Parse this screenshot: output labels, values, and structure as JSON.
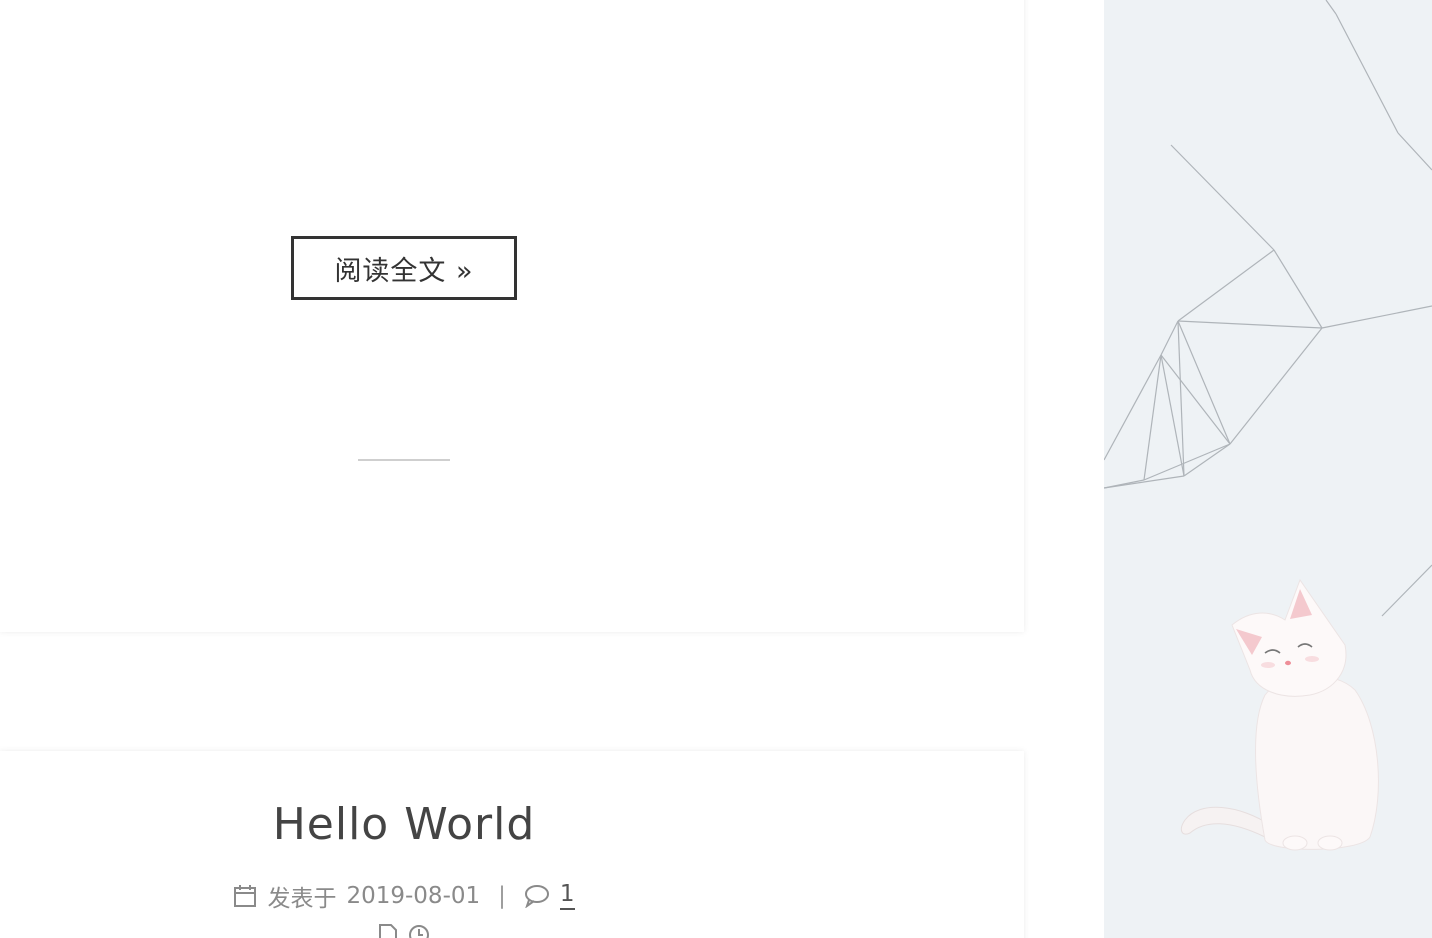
{
  "post_previous": {
    "read_more_label": "阅读全文 »"
  },
  "post_next": {
    "title": "Hello World",
    "meta": {
      "posted_label": "发表于",
      "date": "2019-08-01",
      "separator": "|",
      "comment_count": "1"
    }
  },
  "icons": {
    "calendar": "calendar-icon",
    "comment": "comment-icon",
    "file": "file-icon",
    "clock": "clock-icon"
  },
  "colors": {
    "page_bg": "#ffffff",
    "sidebar_bg": "#eef2f5",
    "text_main": "#444444",
    "text_meta": "#8a8a8a",
    "button_border": "#333333"
  }
}
